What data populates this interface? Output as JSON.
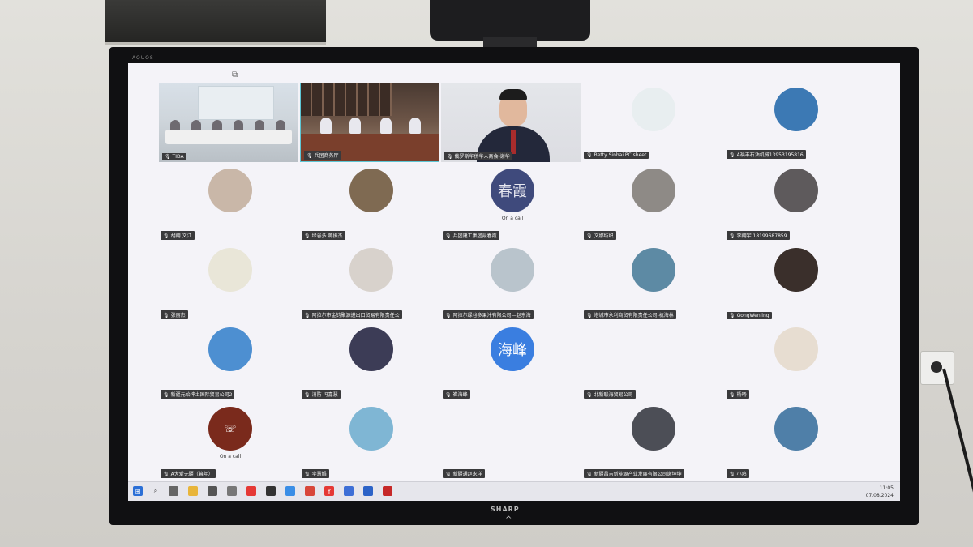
{
  "tv": {
    "brand_top": "AQUOS",
    "brand": "SHARP"
  },
  "video_tiles": [
    {
      "name": "TIDA"
    },
    {
      "name": "兵团商务厅"
    },
    {
      "name": "俄罗斯华侨华人商会-谢华"
    }
  ],
  "participants_row1": [
    {
      "name": "Betty Sinhai PC sheet",
      "on_call": ""
    },
    {
      "name": "A福丰石油机械13953195816",
      "on_call": ""
    }
  ],
  "participants": [
    {
      "name": "胡翔 文江",
      "on_call": "",
      "avatar_text": "",
      "color": "#c9b7a8"
    },
    {
      "name": "绿谷多 蒋振杰",
      "on_call": "",
      "avatar_text": "",
      "color": "#7f6a52"
    },
    {
      "name": "兵团建工集团聂春霞",
      "on_call": "On a call",
      "avatar_text": "春霞",
      "color": "#3f4a7c"
    },
    {
      "name": "文娜纺织",
      "on_call": "",
      "avatar_text": "",
      "color": "#8e8a86"
    },
    {
      "name": "李翔宇 18199687859",
      "on_call": "",
      "avatar_text": "",
      "color": "#5e5a5c"
    },
    {
      "name": "张丽杰",
      "on_call": "",
      "avatar_text": "",
      "color": "#e9e6d8"
    },
    {
      "name": "阿拉尔市金钧聚源进出口贸易有限责任公",
      "on_call": "",
      "avatar_text": "",
      "color": "#d8d2cc"
    },
    {
      "name": "阿拉尔绿谷多果汁有限公司—赵东海",
      "on_call": "",
      "avatar_text": "",
      "color": "#b9c4cc"
    },
    {
      "name": "塔城市永利商贸有限责任公司-杭海林",
      "on_call": "",
      "avatar_text": "",
      "color": "#5d8aa4"
    },
    {
      "name": "GongWenjing",
      "on_call": "",
      "avatar_text": "",
      "color": "#3a2f2b"
    },
    {
      "name": "新疆元始坤土国际贸易公司2",
      "on_call": "",
      "avatar_text": "",
      "color": "#4d8fd1"
    },
    {
      "name": "消防-冯嘉慧",
      "on_call": "",
      "avatar_text": "",
      "color": "#3c3c56"
    },
    {
      "name": "崔海峰",
      "on_call": "",
      "avatar_text": "海峰",
      "color": "#3a7ee0"
    },
    {
      "name": "北新联海贸易公司",
      "on_call": "",
      "avatar_text": "",
      "color": "#f4f3f8"
    },
    {
      "name": "杨旸",
      "on_call": "",
      "avatar_text": "",
      "color": "#e7ddd1"
    },
    {
      "name": "A大爱无疆（暮年）",
      "on_call": "On a call",
      "avatar_text": "",
      "color": "#7a2a1c"
    },
    {
      "name": "李慧娟",
      "on_call": "",
      "avatar_text": "",
      "color": "#7fb6d4"
    },
    {
      "name": "新疆通赵永洋",
      "on_call": "",
      "avatar_text": "",
      "color": "#f4f3f8"
    },
    {
      "name": "新疆昌吉新能源产业发展有限公司谢坤坤",
      "on_call": "",
      "avatar_text": "",
      "color": "#4c4e56"
    },
    {
      "name": "小鸡",
      "on_call": "",
      "avatar_text": "",
      "color": "#4f7fa8"
    }
  ],
  "taskbar": {
    "time": "11:05",
    "date": "07.08.2024"
  }
}
